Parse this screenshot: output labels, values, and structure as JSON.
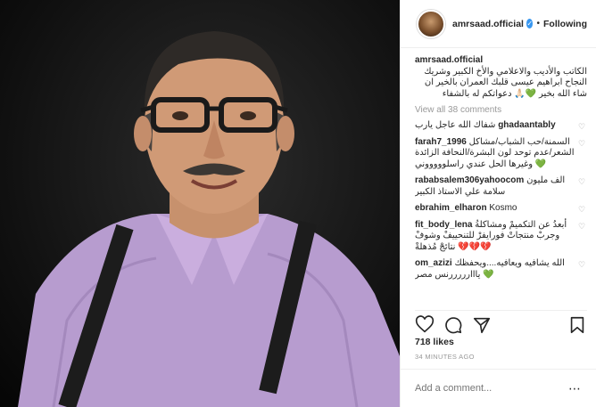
{
  "header": {
    "username": "amrsaad.official",
    "separator": "•",
    "follow_label": "Following"
  },
  "caption": {
    "author": "amrsaad.official",
    "text": "الكاتب والأديب والاعلامي والأخ الكبير وشريك النجاح ابراهيم عيسى قلبك العمران بالخير ان شاء الله بخير 💚🙏🏻 دعواتكم له بالشفاء"
  },
  "view_all": "View all 38 comments",
  "comments": [
    {
      "user": "ghadaantably",
      "text": "شفاك الله عاجل يارب",
      "suffix": ""
    },
    {
      "user": "farah7_1996",
      "text": "السمنة/حب الشباب/مشاكل الشعر/عدم توحد لون البشرة/النحافة الزائدة وغيرها الحل عندي راسلوووووني",
      "suffix": "💚"
    },
    {
      "user": "rababsalem306yahoocom",
      "text": "الف مليون سلامة علي الاستاذ الكبير",
      "suffix": ""
    },
    {
      "user": "ebrahim_elharon",
      "text": "Kosmo",
      "suffix": ""
    },
    {
      "user": "fit_body_lena",
      "text": "أبعدُ عن التكميمْ ومشاكلةُ وجربْ منتجاتْ فورايفرْ للتنحييفْ وشوفْ نتائجْ مُذهلةْ",
      "suffix": "💔💔💔"
    },
    {
      "user": "om_azizi",
      "text": "الله يشافيه ويعافيه....ويحفظك يااارررررنس مصر",
      "suffix": "💚"
    }
  ],
  "likes": "718 likes",
  "time": "34 MINUTES AGO",
  "add_comment": {
    "placeholder": "Add a comment..."
  },
  "colors": {
    "verified": "#3897f0",
    "muted": "#999999",
    "border": "#efefef"
  },
  "icons": [
    "heart-icon",
    "comment-icon",
    "share-icon",
    "bookmark-icon",
    "verified-badge-icon",
    "more-options-icon"
  ]
}
